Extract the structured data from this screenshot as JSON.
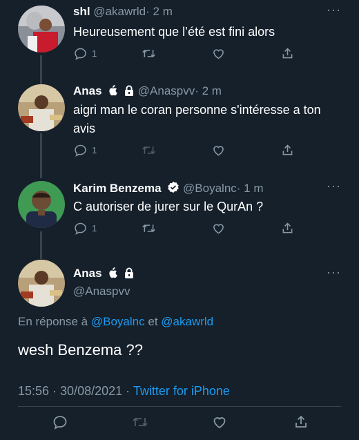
{
  "colors": {
    "background": "#15202b",
    "text": "#ffffff",
    "muted": "#8899a6",
    "link": "#1d9bf0",
    "divider": "#38444d"
  },
  "tweets": [
    {
      "name": "shl",
      "handle": "@akawrld",
      "time": "· 2 m",
      "text": "Heureusement que l’été est fini alors",
      "replies": "1",
      "avatar": "avatar-trophy-player"
    },
    {
      "name": "Anas",
      "handle": "@Anaspvv",
      "time": "· 2 m",
      "text": "aigri man le coran personne s'intéresse a ton avis",
      "replies": "1",
      "avatar": "avatar-cafe-man"
    },
    {
      "name": "Karim Benzema",
      "handle": "@Boyalnc",
      "time": "· 1 m",
      "text": "C autoriser de jurer sur le QurAn ?",
      "replies": "1",
      "avatar": "avatar-benzema"
    }
  ],
  "main_tweet": {
    "name": "Anas",
    "handle": "@Anaspvv",
    "reply_prefix": "En réponse à",
    "reply_mention_1": "@Boyalnc",
    "reply_joiner": "et",
    "reply_mention_2": "@akawrld",
    "text": "wesh Benzema ??",
    "timestamp": "15:56 · 30/08/2021 ·",
    "source": "Twitter for iPhone"
  },
  "icons": [
    "reply-icon",
    "retweet-icon",
    "like-icon",
    "share-icon",
    "more-icon",
    "verified-icon",
    "apple-icon",
    "lock-icon"
  ]
}
